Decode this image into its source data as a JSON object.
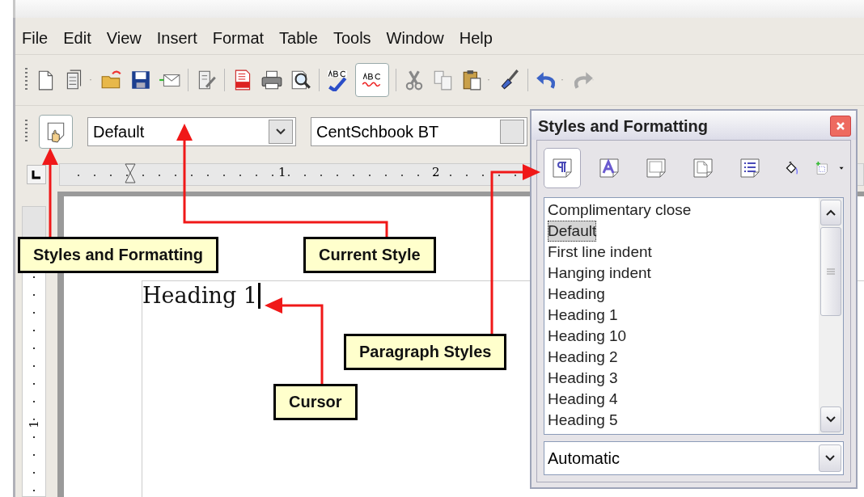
{
  "menu_bar": [
    "File",
    "Edit",
    "View",
    "Insert",
    "Format",
    "Table",
    "Tools",
    "Window",
    "Help"
  ],
  "standard_toolbar": {
    "auto_spellcheck_on": true,
    "redo_disabled": true
  },
  "formatting_toolbar": {
    "styles_button_on": true,
    "paragraph_style": "Default",
    "font_name": "CentSchbook BT"
  },
  "ruler": {
    "labels": [
      "1",
      "2"
    ]
  },
  "vertical_ruler": {
    "labels": [
      "1"
    ]
  },
  "document": {
    "text": "Heading 1"
  },
  "styles_dialog": {
    "title": "Styles and Formatting",
    "families": [
      {
        "kind": "paragraph",
        "selected": true
      },
      {
        "kind": "character",
        "selected": false
      },
      {
        "kind": "frame",
        "selected": false
      },
      {
        "kind": "page",
        "selected": false
      },
      {
        "kind": "list",
        "selected": false
      }
    ],
    "styles": [
      {
        "label": "Complimentary close",
        "selected": false
      },
      {
        "label": "Default",
        "selected": true
      },
      {
        "label": "First line indent",
        "selected": false
      },
      {
        "label": "Hanging indent",
        "selected": false
      },
      {
        "label": "Heading",
        "selected": false
      },
      {
        "label": "Heading 1",
        "selected": false
      },
      {
        "label": "Heading 10",
        "selected": false
      },
      {
        "label": "Heading 2",
        "selected": false
      },
      {
        "label": "Heading 3",
        "selected": false
      },
      {
        "label": "Heading 4",
        "selected": false
      },
      {
        "label": "Heading 5",
        "selected": false
      }
    ],
    "filter": "Automatic"
  },
  "callouts": [
    {
      "kind": "styles_button",
      "text": "Styles and Formatting"
    },
    {
      "kind": "current_style",
      "text": "Current Style"
    },
    {
      "kind": "paragraph_styles",
      "text": "Paragraph Styles"
    },
    {
      "kind": "cursor",
      "text": "Cursor"
    }
  ]
}
